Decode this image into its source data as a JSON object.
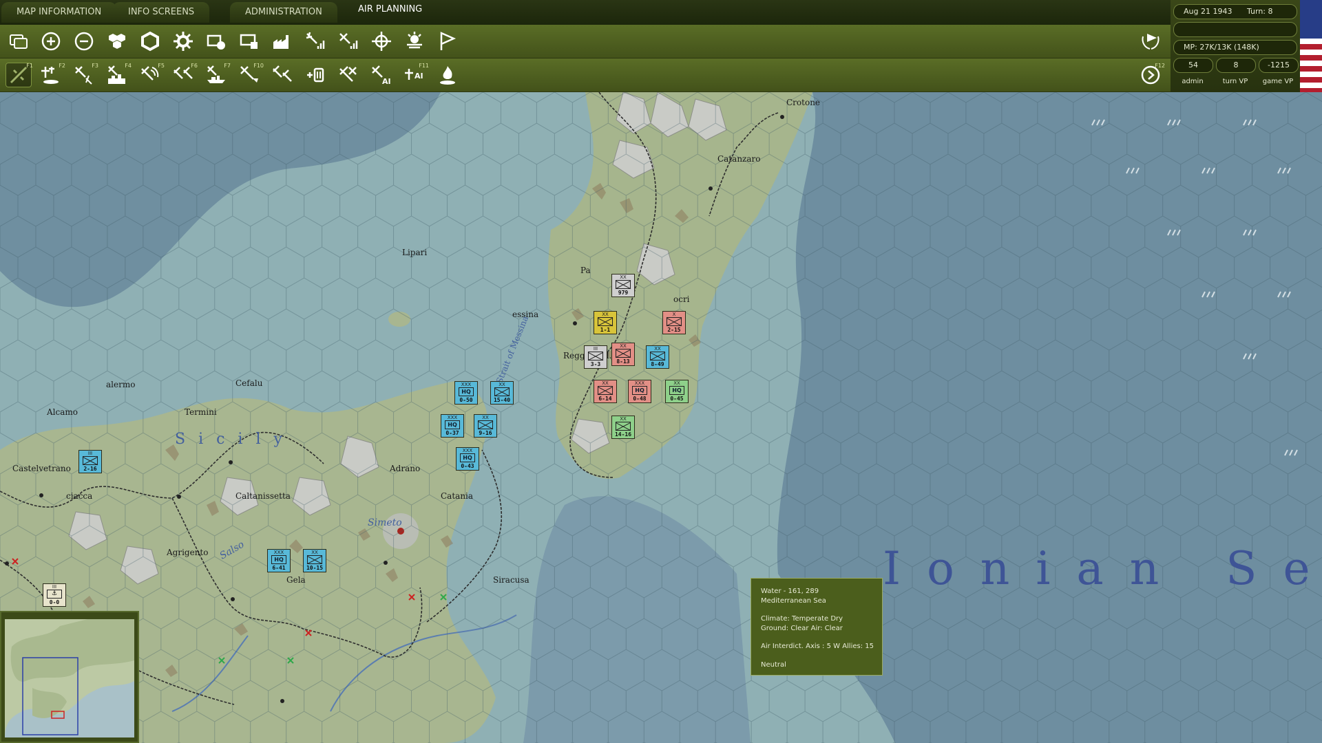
{
  "tabs": [
    {
      "label": "MAP INFORMATION",
      "active": false
    },
    {
      "label": "INFO SCREENS",
      "active": false
    },
    {
      "label": "ADMINISTRATION",
      "active": false
    },
    {
      "label": "AIR PLANNING",
      "active": true
    }
  ],
  "toolbar_top": {
    "icons": [
      "windows-icon",
      "zoom-in-icon",
      "zoom-out-icon",
      "hex-group-icon",
      "hex-frame-icon",
      "gear-icon",
      "unit-box-icon",
      "screen-icon",
      "factory-icon",
      "air-signal-icon",
      "air-bars-icon",
      "airbase-target-icon",
      "weather-icon",
      "flag-outline-icon"
    ],
    "right_icon": "wreath-flag-icon"
  },
  "toolbar_bottom": {
    "buttons": [
      {
        "icon": "air-mission-icon",
        "fkey": "F1"
      },
      {
        "icon": "air-transfer-icon",
        "fkey": "F2"
      },
      {
        "icon": "air-strike-icon",
        "fkey": "F3"
      },
      {
        "icon": "air-bomb-city-icon",
        "fkey": "F4"
      },
      {
        "icon": "air-recon-icon",
        "fkey": "F5"
      },
      {
        "icon": "air-interdict-icon",
        "fkey": "F6"
      },
      {
        "icon": "air-naval-icon",
        "fkey": "F7"
      },
      {
        "icon": "air-ground-icon",
        "fkey": "F10"
      },
      {
        "icon": "air-sweep-icon",
        "fkey": ""
      },
      {
        "icon": "air-rebase-icon",
        "fkey": ""
      },
      {
        "icon": "air-cap-icon",
        "fkey": ""
      },
      {
        "icon": "air-ai-strike-icon",
        "fkey": ""
      },
      {
        "icon": "air-ai-icon",
        "fkey": "F11"
      },
      {
        "icon": "air-burn-icon",
        "fkey": ""
      }
    ],
    "right_fkey": "F12"
  },
  "status": {
    "date": "Aug 21 1943",
    "turn": "Turn: 8",
    "mp": "MP: 27K/13K (148K)",
    "admin_value": "54",
    "admin_label": "admin",
    "turn_vp_value": "8",
    "turn_vp_label": "turn VP",
    "game_vp_value": "-1215",
    "game_vp_label": "game VP"
  },
  "map": {
    "places": [
      {
        "name": "Crotone"
      },
      {
        "name": "Catanzaro"
      },
      {
        "name": "Lipari"
      },
      {
        "name": "Pa"
      },
      {
        "name": "essina"
      },
      {
        "name": "Reggio Cal."
      },
      {
        "name": "ocri"
      },
      {
        "name": "alermo"
      },
      {
        "name": "Cefalu"
      },
      {
        "name": "Alcamo"
      },
      {
        "name": "Termini"
      },
      {
        "name": "Castelvetrano"
      },
      {
        "name": "Caltanissetta"
      },
      {
        "name": "Adrano"
      },
      {
        "name": "Catania"
      },
      {
        "name": "Agrigento"
      },
      {
        "name": "Gela"
      },
      {
        "name": "Siracusa"
      },
      {
        "name": "ciacca"
      }
    ],
    "regions": [
      {
        "name": "S  i  c  i  l  y"
      },
      {
        "name": "Strait of Messina"
      },
      {
        "name": "Simeto"
      },
      {
        "name": "Salso"
      }
    ],
    "sea_name": "Ionian Sea",
    "units": [
      {
        "id": "u1",
        "type": "inf",
        "nation": "italian",
        "level": "XX",
        "strength": "979"
      },
      {
        "id": "u2",
        "type": "inf",
        "nation": "german",
        "level": "XX",
        "strength": "1-1"
      },
      {
        "id": "u3",
        "type": "inf",
        "nation": "british",
        "level": "X",
        "strength": "2-15"
      },
      {
        "id": "u4",
        "type": "inf",
        "nation": "italian",
        "level": "III",
        "strength": "3-3"
      },
      {
        "id": "u5",
        "type": "inf",
        "nation": "british",
        "level": "XX",
        "strength": "8-13"
      },
      {
        "id": "u6",
        "type": "inf",
        "nation": "canadian",
        "level": "XX",
        "strength": "8-49"
      },
      {
        "id": "u7",
        "type": "hq",
        "nation": "canadian",
        "level": "XXX",
        "strength": "0-50"
      },
      {
        "id": "u8",
        "type": "inf",
        "nation": "canadian",
        "level": "XX",
        "strength": "15-40"
      },
      {
        "id": "u9",
        "type": "hq",
        "nation": "canadian",
        "level": "XXX",
        "strength": "0-37"
      },
      {
        "id": "u10",
        "type": "inf",
        "nation": "canadian",
        "level": "XX",
        "strength": "9-16"
      },
      {
        "id": "u11",
        "type": "hq",
        "nation": "canadian",
        "level": "XXX",
        "strength": "0-43"
      },
      {
        "id": "u12",
        "type": "inf",
        "nation": "british",
        "level": "XX",
        "strength": "6-14"
      },
      {
        "id": "u13",
        "type": "hq",
        "nation": "british",
        "level": "XXX",
        "strength": "0-48"
      },
      {
        "id": "u14",
        "type": "hq",
        "nation": "green",
        "level": "XX",
        "strength": "0-45"
      },
      {
        "id": "u15",
        "type": "inf",
        "nation": "green",
        "level": "XX",
        "strength": "14-16"
      },
      {
        "id": "u16",
        "type": "inf",
        "nation": "canadian",
        "level": "III",
        "strength": "2-16"
      },
      {
        "id": "u17",
        "type": "hq",
        "nation": "canadian",
        "level": "XXX",
        "strength": "6-41"
      },
      {
        "id": "u18",
        "type": "inf",
        "nation": "canadian",
        "level": "XX",
        "strength": "10-15"
      },
      {
        "id": "u19",
        "type": "naval",
        "nation": "plain",
        "level": "III",
        "strength": "0-0"
      }
    ]
  },
  "tooltip": {
    "line1": "Water - 161, 289",
    "line2": "Mediterranean Sea",
    "line3": "Climate: Temperate Dry",
    "line4": "Ground: Clear  Air: Clear",
    "line5": "Air Interdict. Axis : 5   W Allies: 15",
    "line6": "Neutral"
  },
  "colors": {
    "german": "#d8c43a",
    "italian": "#cfcfcf",
    "british": "#e28f86",
    "canadian": "#58b9d8",
    "green": "#8ed08a",
    "plain": "#e8e4cc",
    "sea": "#8aa7ad",
    "land": "#a7b58f",
    "chrome": "#4f6020"
  }
}
